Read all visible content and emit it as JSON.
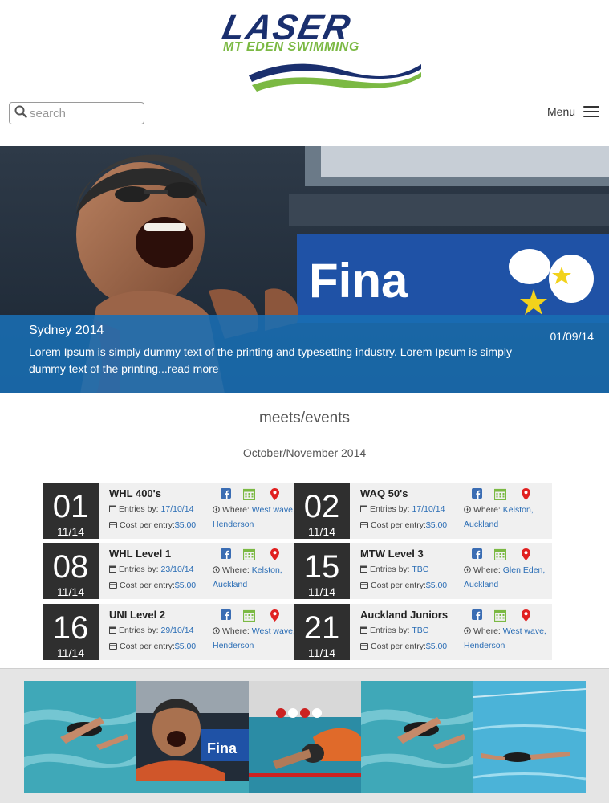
{
  "header": {
    "logo_main": "LASER",
    "logo_sub": "MT EDEN SWIMMING",
    "search_placeholder": "search",
    "menu_label": "Menu"
  },
  "hero": {
    "title": "Sydney 2014",
    "date": "01/09/14",
    "text": "Lorem Ipsum is simply dummy text of the printing and typesetting industry. Lorem Ipsum is simply dummy text of the printing...read more",
    "banner_text": "Fina"
  },
  "meets": {
    "title": "meets/events",
    "period": "October/November 2014",
    "entries_label": "Entries by:",
    "cost_label": "Cost per entry:",
    "where_label": "Where:",
    "events": [
      {
        "day": "01",
        "month": "11/14",
        "title": "WHL 400's",
        "entries": "17/10/14",
        "cost": "$5.00",
        "where": "West wave, Henderson"
      },
      {
        "day": "02",
        "month": "11/14",
        "title": "WAQ 50's",
        "entries": "17/10/14",
        "cost": "$5.00",
        "where": "Kelston, Auckland"
      },
      {
        "day": "08",
        "month": "11/14",
        "title": "WHL Level 1",
        "entries": "23/10/14",
        "cost": "$5.00",
        "where": "Kelston, Auckland"
      },
      {
        "day": "15",
        "month": "11/14",
        "title": "MTW Level 3",
        "entries": "TBC",
        "cost": "$5.00",
        "where": "Glen Eden, Auckland"
      },
      {
        "day": "16",
        "month": "11/14",
        "title": "UNI Level 2",
        "entries": "29/10/14",
        "cost": "$5.00",
        "where": "West wave, Henderson"
      },
      {
        "day": "21",
        "month": "11/14",
        "title": "Auckland Juniors",
        "entries": "TBC",
        "cost": "$5.00",
        "where": "West wave, Henderson"
      }
    ]
  },
  "icons": {
    "search": "search-icon",
    "menu": "hamburger-icon",
    "facebook": "facebook-icon",
    "calendar": "calendar-icon",
    "location": "map-pin-icon",
    "small_calendar": "small-calendar-icon",
    "card": "card-icon",
    "compass": "compass-icon"
  },
  "colors": {
    "brand_navy": "#1a2f6e",
    "brand_green": "#7bb943",
    "link_blue": "#2a6db5",
    "caption_blue": "#196eb4",
    "date_box": "#2f2f2f",
    "card_bg": "#f0f0f0",
    "facebook": "#3b6db3",
    "calendar": "#7bb943",
    "pin": "#e02020"
  },
  "gallery": {
    "count": 5
  }
}
